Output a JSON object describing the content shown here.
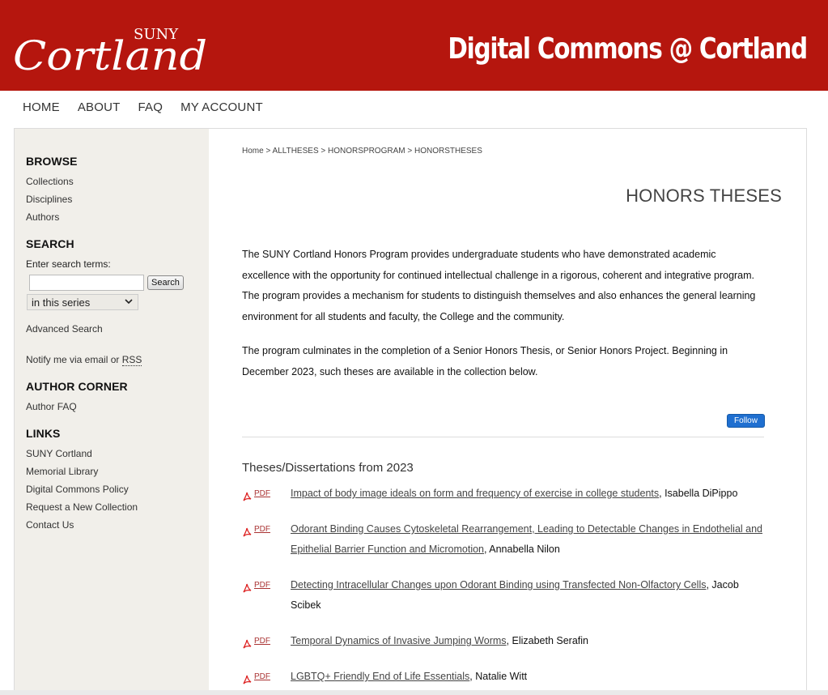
{
  "header": {
    "logo_suny": "SUNY",
    "logo_word": "Cortland",
    "site_title": "Digital Commons @ Cortland",
    "brand_color": "#b5160e"
  },
  "nav": [
    "HOME",
    "ABOUT",
    "FAQ",
    "MY ACCOUNT"
  ],
  "sidebar": {
    "browse": {
      "heading": "BROWSE",
      "links": [
        "Collections",
        "Disciplines",
        "Authors"
      ]
    },
    "search": {
      "heading": "SEARCH",
      "label": "Enter search terms:",
      "input_value": "",
      "button": "Search",
      "scope": "in this series",
      "advanced": "Advanced Search",
      "notify_prefix": "Notify me via email or ",
      "rss": "RSS"
    },
    "author_corner": {
      "heading": "AUTHOR CORNER",
      "links": [
        "Author FAQ"
      ]
    },
    "links": {
      "heading": "LINKS",
      "links": [
        "SUNY Cortland",
        "Memorial Library",
        "Digital Commons Policy",
        "Request a New Collection",
        "Contact Us"
      ]
    }
  },
  "breadcrumb": {
    "home": "Home",
    "sep": ">",
    "items": [
      "ALLTHESES",
      "HONORSPROGRAM",
      "HONORSTHESES"
    ]
  },
  "main": {
    "title": "HONORS THESES",
    "intro": [
      "The SUNY Cortland Honors Program provides undergraduate students who have demonstrated academic excellence with the opportunity for continued intellectual challenge in a rigorous, coherent and integrative program. The program provides a mechanism for students to distinguish themselves and also enhances the general learning environment for all students and faculty, the College and the community.",
      "The program culminates in the completion of a Senior Honors Thesis, or Senior Honors Project. Beginning in December 2023, such theses are available in the collection below."
    ],
    "follow": "Follow",
    "list_heading": "Theses/Dissertations from 2023",
    "pdf_label": "PDF",
    "items": [
      {
        "title": "Impact of body image ideals on form and frequency of exercise in college students",
        "author": ", Isabella DiPippo"
      },
      {
        "title": "Odorant Binding Causes Cytoskeletal Rearrangement, Leading to Detectable Changes in Endothelial and Epithelial Barrier Function and Micromotion",
        "author": ", Annabella Nilon"
      },
      {
        "title": "Detecting Intracellular Changes upon Odorant Binding using Transfected Non-Olfactory Cells",
        "author": ", Jacob Scibek"
      },
      {
        "title": "Temporal Dynamics of Invasive Jumping Worms",
        "author": ", Elizabeth Serafin"
      },
      {
        "title": "LGBTQ+ Friendly End of Life Essentials",
        "author": ", Natalie Witt"
      }
    ]
  }
}
